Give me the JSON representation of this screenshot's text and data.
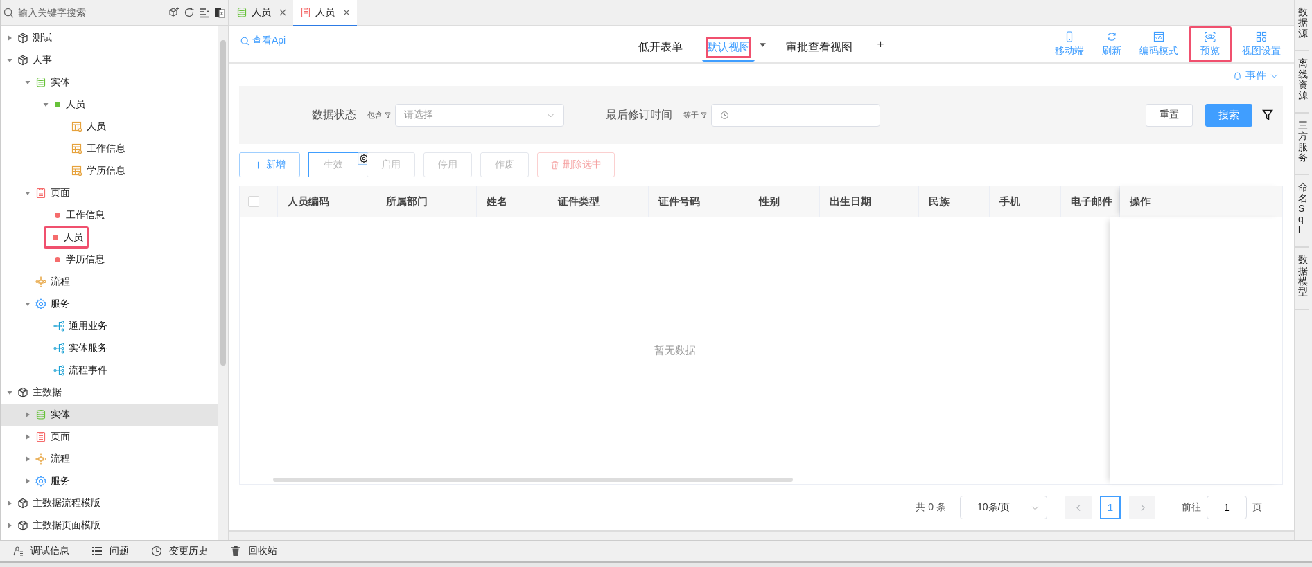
{
  "search": {
    "placeholder": "输入关键字搜索"
  },
  "tree": [
    {
      "label": "测试",
      "kind": "module",
      "expanded": false,
      "selected": false,
      "highlighted": false
    },
    {
      "label": "人事",
      "kind": "module",
      "expanded": true,
      "selected": false,
      "highlighted": false,
      "children": [
        {
          "label": "实体",
          "kind": "entity",
          "expanded": true,
          "selected": false,
          "highlighted": false,
          "children": [
            {
              "label": "人员",
              "kind": "dot",
              "color": "#67c23a",
              "expanded": true,
              "selected": false,
              "highlighted": false,
              "children": [
                {
                  "label": "人员",
                  "kind": "table",
                  "selected": false,
                  "highlighted": false
                },
                {
                  "label": "工作信息",
                  "kind": "table",
                  "selected": false,
                  "highlighted": false
                },
                {
                  "label": "学历信息",
                  "kind": "table",
                  "selected": false,
                  "highlighted": false
                }
              ]
            }
          ]
        },
        {
          "label": "页面",
          "kind": "page",
          "expanded": true,
          "selected": false,
          "highlighted": false,
          "children": [
            {
              "label": "工作信息",
              "kind": "dot",
              "color": "#f56c6c",
              "selected": false,
              "highlighted": false
            },
            {
              "label": "人员",
              "kind": "dot",
              "color": "#f56c6c",
              "selected": false,
              "highlighted": true
            },
            {
              "label": "学历信息",
              "kind": "dot",
              "color": "#f56c6c",
              "selected": false,
              "highlighted": false
            }
          ]
        },
        {
          "label": "流程",
          "kind": "flow",
          "selected": false,
          "highlighted": false
        },
        {
          "label": "服务",
          "kind": "service",
          "expanded": true,
          "selected": false,
          "highlighted": false,
          "children": [
            {
              "label": "通用业务",
              "kind": "branch",
              "selected": false,
              "highlighted": false
            },
            {
              "label": "实体服务",
              "kind": "branch",
              "selected": false,
              "highlighted": false
            },
            {
              "label": "流程事件",
              "kind": "branch",
              "selected": false,
              "highlighted": false
            }
          ]
        }
      ]
    },
    {
      "label": "主数据",
      "kind": "module",
      "expanded": true,
      "selected": false,
      "highlighted": false,
      "children": [
        {
          "label": "实体",
          "kind": "entity",
          "expanded": false,
          "selected": true,
          "highlighted": false
        },
        {
          "label": "页面",
          "kind": "page",
          "expanded": false,
          "selected": false,
          "highlighted": false
        },
        {
          "label": "流程",
          "kind": "flow",
          "expanded": false,
          "selected": false,
          "highlighted": false
        },
        {
          "label": "服务",
          "kind": "service",
          "expanded": false,
          "selected": false,
          "highlighted": false
        }
      ]
    },
    {
      "label": "主数据流程模版",
      "kind": "module",
      "expanded": false,
      "selected": false,
      "highlighted": false
    },
    {
      "label": "主数据页面模版",
      "kind": "module",
      "expanded": false,
      "selected": false,
      "highlighted": false
    }
  ],
  "editor_tabs": [
    {
      "label": "人员",
      "kind": "entity",
      "selected": false
    },
    {
      "label": "人员",
      "kind": "page",
      "selected": true
    }
  ],
  "api_link": "查看Api",
  "view_tabs": [
    {
      "label": "低开表单",
      "selected": false,
      "highlighted": false,
      "dropdown": false
    },
    {
      "label": "默认视图",
      "selected": true,
      "highlighted": true,
      "dropdown": true
    },
    {
      "label": "审批查看视图",
      "selected": false,
      "highlighted": false,
      "dropdown": false
    }
  ],
  "add_view": "+",
  "tools": [
    {
      "label": "移动端",
      "kind": "mobile",
      "highlighted": false
    },
    {
      "label": "刷新",
      "kind": "refresh",
      "highlighted": false
    },
    {
      "label": "编码模式",
      "kind": "code",
      "highlighted": false
    },
    {
      "label": "预览",
      "kind": "preview",
      "highlighted": true
    },
    {
      "label": "视图设置",
      "kind": "grid",
      "highlighted": false
    }
  ],
  "events": "事件",
  "filters": [
    {
      "label": "数据状态",
      "operator": "包含",
      "kind": "select",
      "placeholder": "请选择"
    },
    {
      "label": "最后修订时间",
      "operator": "等于",
      "kind": "date"
    }
  ],
  "filter_buttons": {
    "reset": "重置",
    "search": "搜索"
  },
  "actions": [
    {
      "label": "新增",
      "kind": "add",
      "disabled": false,
      "selected": false
    },
    {
      "label": "生效",
      "kind": "plain",
      "disabled": true,
      "selected": true
    },
    {
      "label": "启用",
      "kind": "plain",
      "disabled": true,
      "selected": false
    },
    {
      "label": "停用",
      "kind": "plain",
      "disabled": true,
      "selected": false
    },
    {
      "label": "作废",
      "kind": "plain",
      "disabled": true,
      "selected": false
    },
    {
      "label": "删除选中",
      "kind": "delete",
      "disabled": true,
      "selected": false
    }
  ],
  "table": {
    "select_all_checked": false,
    "columns": [
      "人员编码",
      "所属部门",
      "姓名",
      "证件类型",
      "证件号码",
      "性别",
      "出生日期",
      "民族",
      "手机",
      "电子邮件"
    ],
    "fixed_column": "操作",
    "empty_text": "暂无数据"
  },
  "pagination": {
    "total": "共 0 条",
    "page_size": "10条/页",
    "pages": [
      {
        "label": "1",
        "selected": true
      }
    ],
    "goto_label": "前往",
    "goto_value": "1",
    "goto_suffix": "页"
  },
  "bottom_bar": [
    {
      "label": "调试信息",
      "kind": "debug"
    },
    {
      "label": "问题",
      "kind": "list"
    },
    {
      "label": "变更历史",
      "kind": "clock"
    },
    {
      "label": "回收站",
      "kind": "trash"
    }
  ],
  "right_tabs": [
    "数据源",
    "离线资源",
    "三方服务",
    "命名Sql",
    "数据模型"
  ]
}
